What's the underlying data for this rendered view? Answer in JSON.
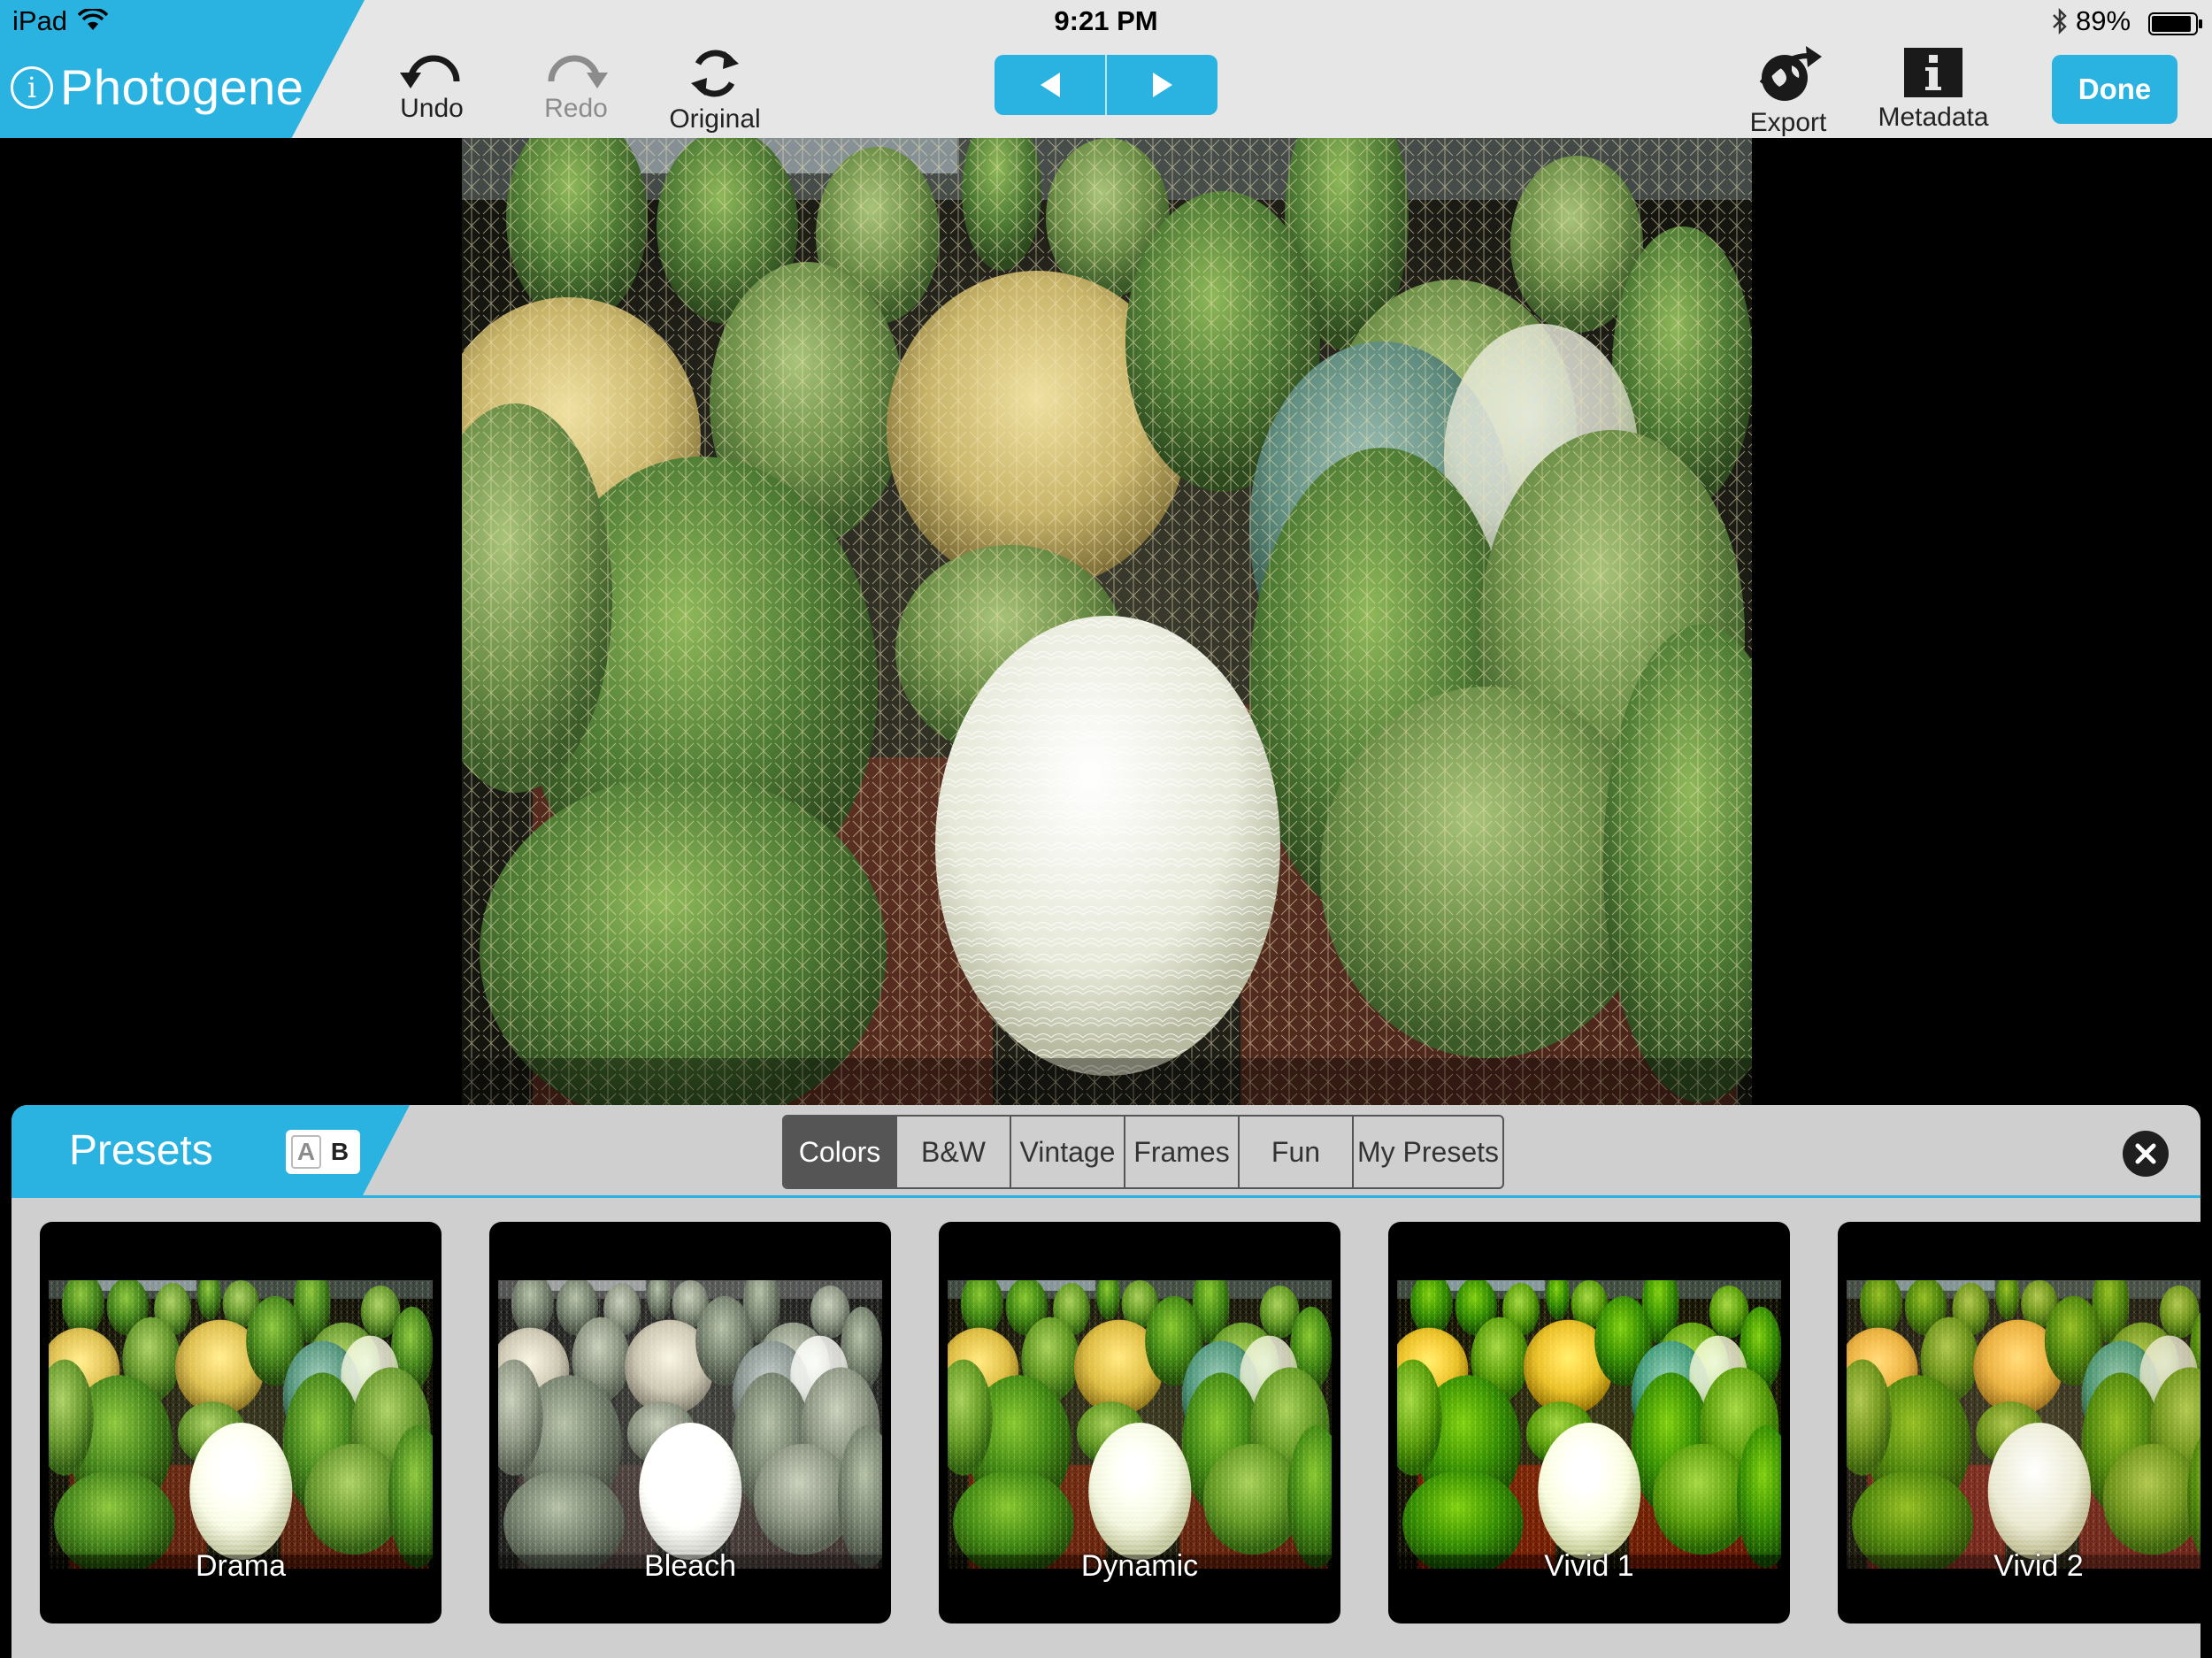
{
  "status_bar": {
    "device": "iPad",
    "time": "9:21 PM",
    "battery": "89%"
  },
  "app": {
    "name": "Photogene"
  },
  "toolbar": {
    "undo_label": "Undo",
    "redo_label": "Redo",
    "original_label": "Original",
    "export_label": "Export",
    "metadata_label": "Metadata",
    "done_label": "Done"
  },
  "presets_panel": {
    "title": "Presets",
    "ab": {
      "a": "A",
      "b": "B"
    },
    "tabs": [
      {
        "label": "Colors",
        "active": true
      },
      {
        "label": "B&W",
        "active": false
      },
      {
        "label": "Vintage",
        "active": false
      },
      {
        "label": "Frames",
        "active": false
      },
      {
        "label": "Fun",
        "active": false
      },
      {
        "label": "My Presets",
        "active": false
      }
    ],
    "items": [
      {
        "label": "Drama"
      },
      {
        "label": "Bleach"
      },
      {
        "label": "Dynamic"
      },
      {
        "label": "Vivid 1"
      },
      {
        "label": "Vivid 2"
      }
    ]
  },
  "colors": {
    "accent": "#2ab3e0",
    "toolbar_bg": "#e6e6e6",
    "panel_bg": "#cfcfcf"
  },
  "icons": {
    "undo": "undo-icon",
    "redo": "redo-icon",
    "original": "refresh-icon",
    "prev": "triangle-left-icon",
    "next": "triangle-right-icon",
    "export": "globe-arrow-icon",
    "metadata": "info-icon",
    "close": "close-icon"
  }
}
